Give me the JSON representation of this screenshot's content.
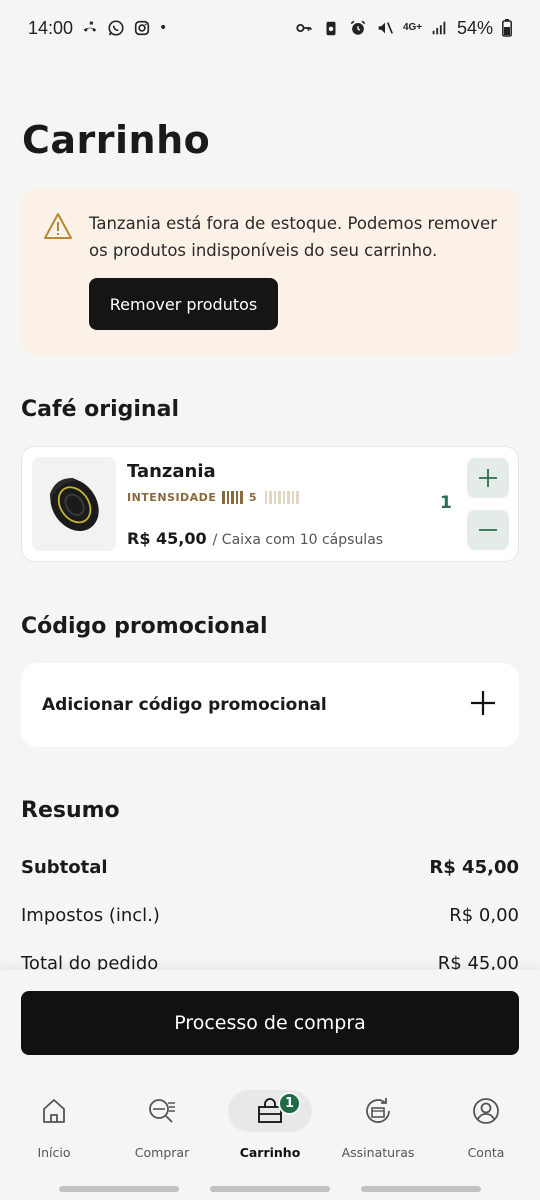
{
  "status_bar": {
    "time": "14:00",
    "battery": "54%",
    "network": "4G+",
    "dot": "•"
  },
  "page": {
    "title": "Carrinho"
  },
  "alert": {
    "icon": "warning-icon",
    "message": "Tanzania está fora de estoque. Podemos remover os produtos indisponíveis do seu carrinho.",
    "button_label": "Remover produtos"
  },
  "section_cafe": {
    "title": "Café original"
  },
  "product": {
    "name": "Tanzania",
    "intensity_label": "INTENSIDADE",
    "intensity_value": "5",
    "intensity_level": 5,
    "intensity_max": 13,
    "price": "R$ 45,00",
    "price_detail": "/ Caixa com 10 cápsulas",
    "quantity": "1"
  },
  "promo": {
    "title": "Código promocional",
    "add_label": "Adicionar código promocional"
  },
  "summary": {
    "title": "Resumo",
    "rows": [
      {
        "label": "Subtotal",
        "value": "R$ 45,00"
      },
      {
        "label": "Impostos (incl.)",
        "value": "R$ 0,00"
      },
      {
        "label": "Total do pedido",
        "value": "R$ 45,00"
      }
    ]
  },
  "checkout": {
    "button_label": "Processo de compra"
  },
  "nav": {
    "items": [
      {
        "label": "Início",
        "icon": "home-icon"
      },
      {
        "label": "Comprar",
        "icon": "coffee-search-icon"
      },
      {
        "label": "Carrinho",
        "icon": "shopping-bag-icon",
        "badge": "1"
      },
      {
        "label": "Assinaturas",
        "icon": "subscription-icon"
      },
      {
        "label": "Conta",
        "icon": "account-icon"
      }
    ]
  },
  "colors": {
    "accent_green": "#2c6e4f",
    "badge_green": "#1f6b45",
    "alert_bg": "#fbf1e6",
    "intensity_brown": "#8a6a3c"
  }
}
